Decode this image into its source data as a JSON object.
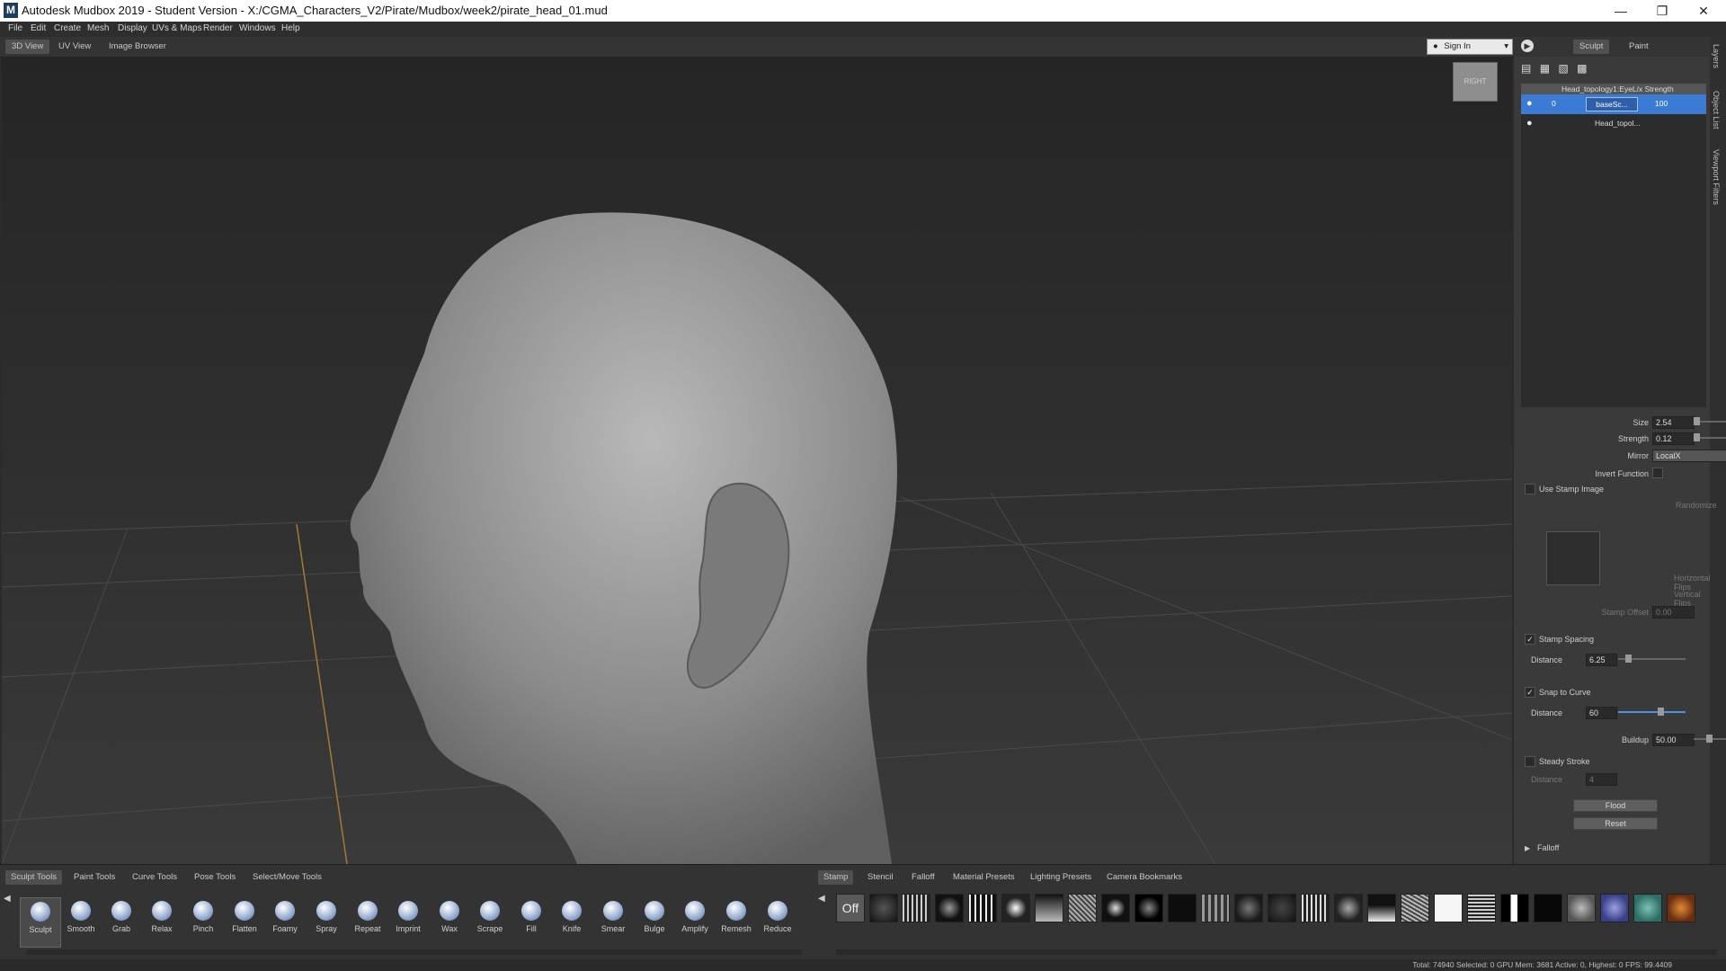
{
  "window": {
    "title": "Autodesk Mudbox 2019 - Student Version - X:/CGMA_Characters_V2/Pirate/Mudbox/week2/pirate_head_01.mud",
    "logo": "M",
    "controls": [
      "minimize-icon",
      "restore-icon",
      "close-icon"
    ]
  },
  "menu": [
    "File",
    "Edit",
    "Create",
    "Mesh",
    "Display",
    "UVs & Maps",
    "Render",
    "Windows",
    "Help"
  ],
  "view_tabs": [
    "3D View",
    "UV View",
    "Image Browser"
  ],
  "top_right": {
    "sign_in": "Sign In",
    "modes": [
      "Sculpt",
      "Paint"
    ]
  },
  "side_tabs": [
    "Layers",
    "Object List",
    "Viewport Filters"
  ],
  "viewcube_label": "RIGHT",
  "layers": {
    "header": "Head_topology1:EyeL/x Strength",
    "rows": [
      {
        "name": "baseSc...",
        "value": "0",
        "strength": "100",
        "selected": true
      },
      {
        "name": "Head_topol...",
        "value": "",
        "strength": "",
        "selected": false
      }
    ]
  },
  "properties": {
    "size_label": "Size",
    "size_value": "2.54",
    "strength_label": "Strength",
    "strength_value": "0.12",
    "mirror_label": "Mirror",
    "mirror_value": "LocalX",
    "invert_label": "Invert Function",
    "use_stamp_label": "Use Stamp Image",
    "randomize_label": "Randomize",
    "hflips_label": "Horizontal Flips",
    "vflips_label": "Vertical Flips",
    "stamp_offset_label": "Stamp Offset",
    "stamp_offset_value": "0.00",
    "stamp_spacing_label": "Stamp Spacing",
    "stamp_spacing_checked": true,
    "spacing_distance_label": "Distance",
    "spacing_distance_value": "6.25",
    "snap_label": "Snap to Curve",
    "snap_checked": true,
    "snap_distance_label": "Distance",
    "snap_distance_value": "60",
    "buildup_label": "Buildup",
    "buildup_value": "50.00",
    "steady_label": "Steady Stroke",
    "steady_checked": false,
    "steady_distance_label": "Distance",
    "steady_distance_value": "4",
    "flood_label": "Flood",
    "reset_label": "Reset",
    "falloff_label": "Falloff"
  },
  "tool_tabs": [
    "Sculpt Tools",
    "Paint Tools",
    "Curve Tools",
    "Pose Tools",
    "Select/Move Tools"
  ],
  "tools": [
    "Sculpt",
    "Smooth",
    "Grab",
    "Relax",
    "Pinch",
    "Flatten",
    "Foamy",
    "Spray",
    "Repeat",
    "Imprint",
    "Wax",
    "Scrape",
    "Fill",
    "Knife",
    "Smear",
    "Bulge",
    "Amplify",
    "Remesh",
    "Reduce"
  ],
  "stamp_tabs": [
    "Stamp",
    "Stencil",
    "Falloff",
    "Material Presets",
    "Lighting Presets",
    "Camera Bookmarks"
  ],
  "stamp_off_label": "Off",
  "status": "Total: 74940  Selected: 0 GPU Mem: 3681  Active: 0, Highest: 0  FPS: 99.4409"
}
